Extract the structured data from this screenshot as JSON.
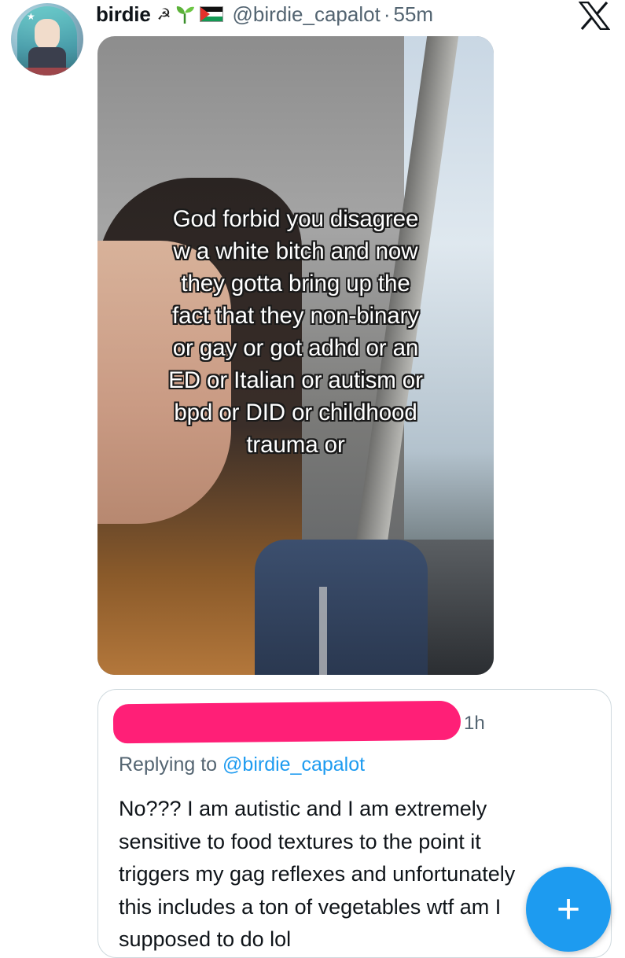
{
  "tweet": {
    "author": {
      "display_name": "birdie",
      "handle": "@birdie_capalot",
      "badges": [
        "hammer-sickle-icon",
        "sprout-icon",
        "palestine-flag-icon"
      ]
    },
    "separator": "·",
    "timestamp": "55m",
    "media": {
      "caption_lines": [
        "God forbid you disagree",
        "w a white bitch and now",
        "they gotta bring up the",
        "fact that they non-binary",
        "or gay or got adhd or an",
        "ED or Italian or autism or",
        "bpd or DID or childhood",
        "trauma or"
      ]
    }
  },
  "reply": {
    "timestamp": "1h",
    "replying_to_prefix": "Replying to ",
    "replying_to_handle": "@birdie_capalot",
    "body_lines": [
      "No??? I am autistic and I am extremely",
      "sensitive to food textures to the point it",
      "triggers my gag reflexes and unfortunately",
      "this includes a ton of vegetables wtf am I",
      "supposed to do lol"
    ]
  },
  "compose_button": {
    "label": "+"
  },
  "colors": {
    "accent": "#1d9bf0",
    "redaction": "#ff1f77",
    "secondary_text": "#536471"
  }
}
